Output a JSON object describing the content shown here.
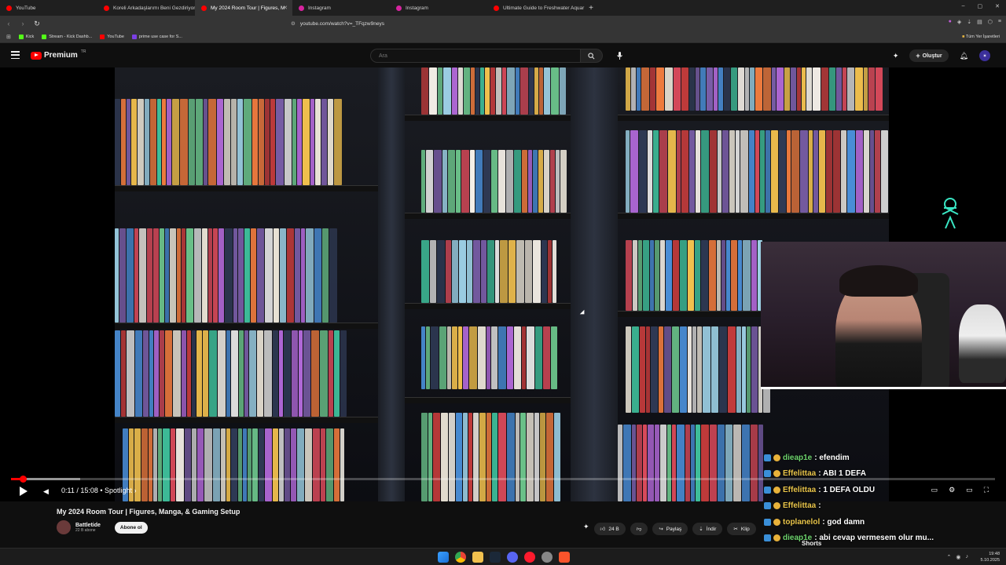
{
  "browser": {
    "tabs": [
      {
        "label": "YouTube",
        "color": "#ff0000",
        "active": false
      },
      {
        "label": "Koreli Arkadaşlarımı Beni Gezdiriyor |",
        "color": "#ff0000",
        "active": false
      },
      {
        "label": "My 2024 Room Tour | Figures, M",
        "color": "#ff0000",
        "active": true
      },
      {
        "label": "Instagram",
        "color": "#d6249f",
        "active": false
      },
      {
        "label": "Instagram",
        "color": "#d6249f",
        "active": false
      },
      {
        "label": "Ultimate Guide to Freshwater Aquar",
        "color": "#ff0000",
        "active": false
      }
    ],
    "new_tab": "+",
    "window_controls": [
      "–",
      "▢",
      "✕"
    ],
    "url": "youtube.com/watch?v=_TFqzw9neys",
    "bookmarks": [
      {
        "label": "Kick",
        "color": "#53fc18"
      },
      {
        "label": "Stream - Kick Dashb...",
        "color": "#53fc18"
      },
      {
        "label": "YouTube",
        "color": "#ff0000"
      },
      {
        "label": "prime use case for S...",
        "color": "#7b3fe4"
      }
    ],
    "bookmarks_folder": "Tüm Yer İşaretleri"
  },
  "youtube": {
    "logo_text": "Premium",
    "logo_region": "TR",
    "search_placeholder": "Ara",
    "create_label": "Oluştur"
  },
  "player": {
    "played_fraction": 0.012,
    "buffered_fraction": 0.07,
    "time": "0:11 / 15:08 • Spotlight ›",
    "accent": "#ff0000"
  },
  "chat": [
    {
      "user": "dieap1e",
      "msg": ": efendim",
      "user_color": "#6dd36d"
    },
    {
      "user": "Effelittaa",
      "msg": ": ABI 1 DEFA",
      "user_color": "#e8c44a"
    },
    {
      "user": "Effelittaa",
      "msg": ": 1 DEFA OLDU",
      "user_color": "#e8c44a"
    },
    {
      "user": "Effelittaa",
      "msg": ": ",
      "user_color": "#e8c44a"
    },
    {
      "user": "toplanelol",
      "msg": ": god damn",
      "user_color": "#e8c44a"
    },
    {
      "user": "dieap1e",
      "msg": ": abi cevap vermesem olur mu...",
      "user_color": "#6dd36d"
    }
  ],
  "video_info": {
    "title": "My 2024 Room Tour | Figures, Manga, & Gaming Setup",
    "channel": "Battletide",
    "subscribers": "22 B abone",
    "subscribe_label": "Abone ol",
    "likes": "24 B",
    "share_label": "Paylaş",
    "download_label": "İndir",
    "clip_label": "Klip",
    "shorts_label": "Shorts"
  },
  "taskbar": {
    "time": "19:48",
    "date": "5.10.2025"
  }
}
